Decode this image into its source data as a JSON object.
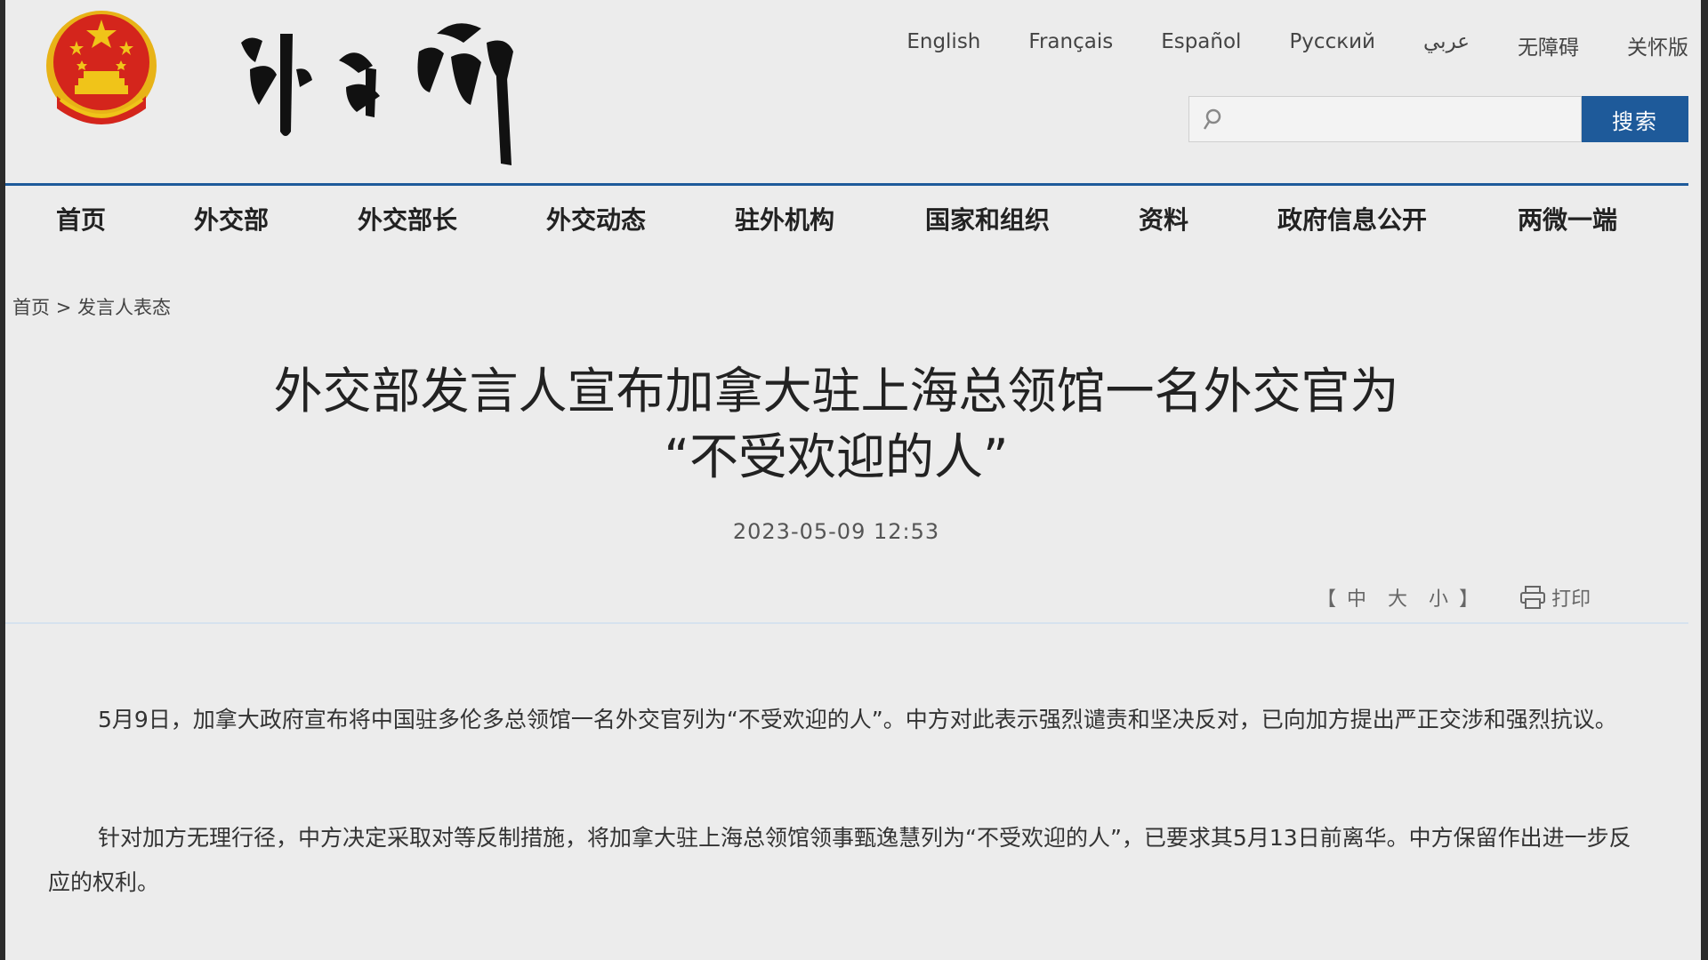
{
  "header": {
    "emblem_icon": "national-emblem-icon",
    "logo_text": "外交部",
    "languages": [
      "English",
      "Français",
      "Español",
      "Русский",
      "عربي",
      "无障碍",
      "关怀版"
    ],
    "search": {
      "placeholder": "",
      "value": "",
      "button_label": "搜索",
      "icon": "search-icon"
    }
  },
  "colors": {
    "accent": "#1e5a9a",
    "emblem_red": "#d4251c",
    "emblem_gold": "#f0c419"
  },
  "nav": {
    "items": [
      "首页",
      "外交部",
      "外交部长",
      "外交动态",
      "驻外机构",
      "国家和组织",
      "资料",
      "政府信息公开",
      "两微一端"
    ]
  },
  "breadcrumb": {
    "home": "首页",
    "separator": ">",
    "current": "发言人表态"
  },
  "article": {
    "title_line1": "外交部发言人宣布加拿大驻上海总领馆一名外交官为",
    "title_line2": "“不受欢迎的人”",
    "date": "2023-05-09 12:53",
    "font_size": {
      "open": "【",
      "medium": "中",
      "large": "大",
      "small": "小",
      "close": "】"
    },
    "print_label": "打印",
    "print_icon": "printer-icon",
    "paragraphs": [
      "5月9日，加拿大政府宣布将中国驻多伦多总领馆一名外交官列为“不受欢迎的人”。中方对此表示强烈谴责和坚决反对，已向加方提出严正交涉和强烈抗议。",
      "针对加方无理行径，中方决定采取对等反制措施，将加拿大驻上海总领馆领事甄逸慧列为“不受欢迎的人”，已要求其5月13日前离华。中方保留作出进一步反应的权利。"
    ]
  }
}
